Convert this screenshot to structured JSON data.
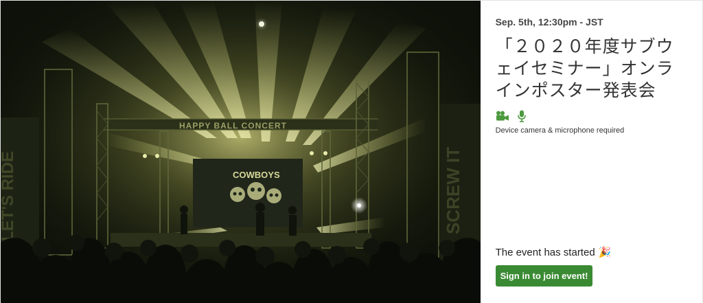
{
  "event": {
    "date": "Sep. 5th, 12:30pm - JST",
    "title": "「２０２０年度サブウェイセミナー」オンラインポスター発表会",
    "requirements_text": "Device camera & microphone required",
    "requirement_icons": [
      "video-camera-icon",
      "microphone-icon"
    ],
    "status_text": "The event has started",
    "status_emoji": "🎉",
    "join_button_label": "Sign in to join event!"
  },
  "hero": {
    "stage_banner_text": "COWBOYS",
    "scaffold_left_text": "LET'S RIDE",
    "scaffold_right_text": "SCREW IT"
  },
  "colors": {
    "accent_green": "#3a8a33",
    "icon_green": "#4c9a3f"
  }
}
